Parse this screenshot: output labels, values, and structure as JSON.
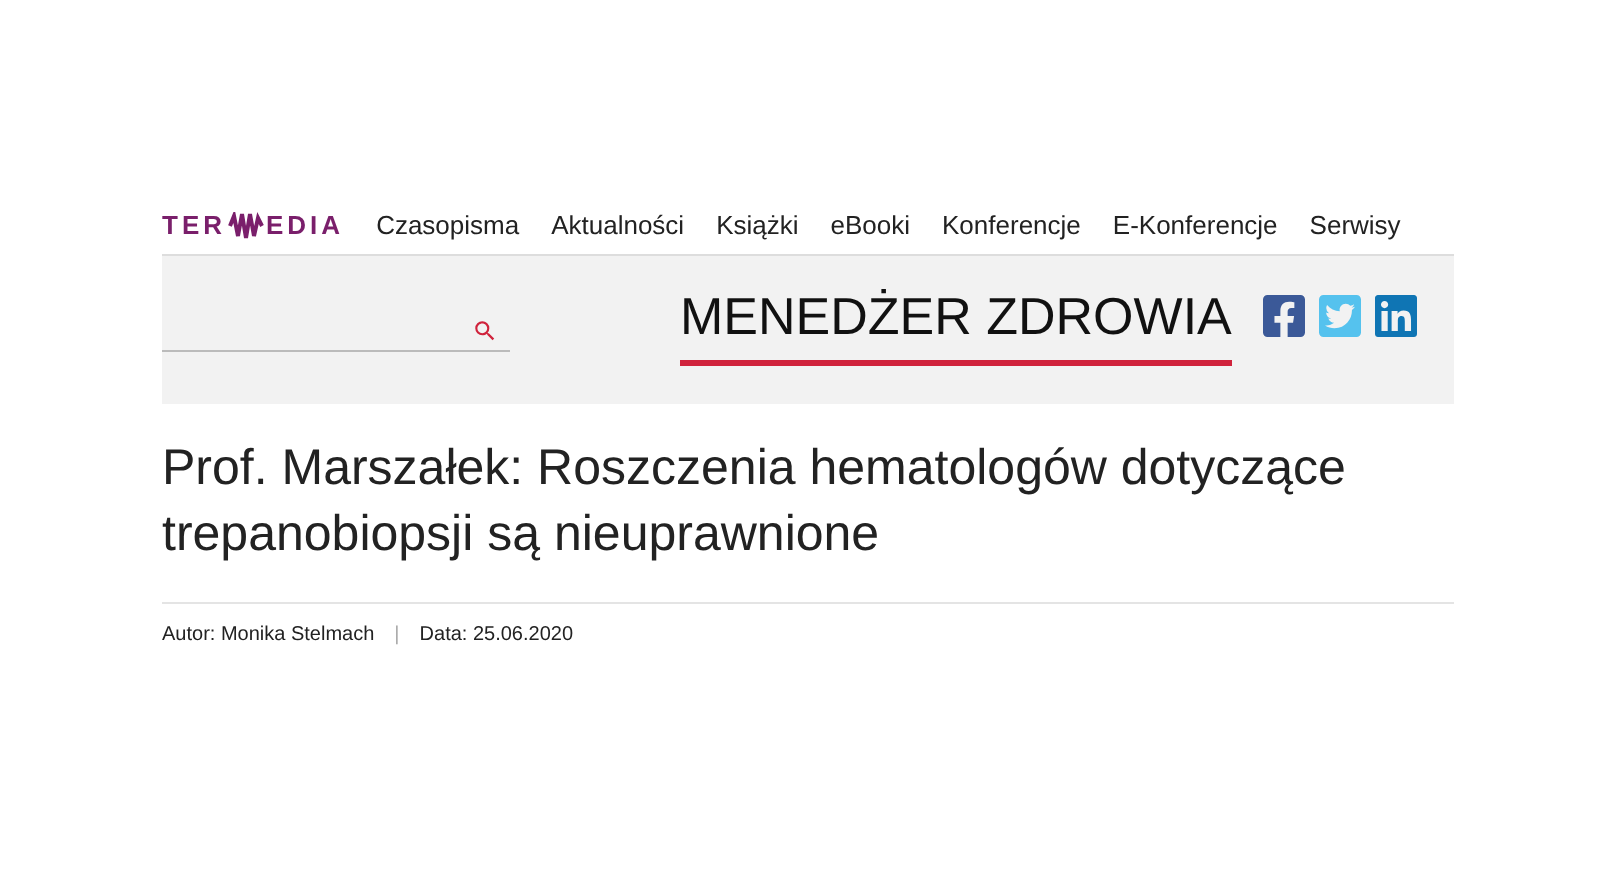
{
  "logo": {
    "left": "TER",
    "right": "EDIA"
  },
  "nav": [
    "Czasopisma",
    "Aktualności",
    "Książki",
    "eBooki",
    "Konferencje",
    "E-Konferencje",
    "Serwisy"
  ],
  "section_title": "MENEDŻER ZDROWIA",
  "article": {
    "title": "Prof. Marszałek: Roszczenia hematologów dotyczące trepanobiopsji są nieuprawnione",
    "author": "Autor: Monika Stelmach",
    "separator": "|",
    "date": "Data: 25.06.2020"
  }
}
